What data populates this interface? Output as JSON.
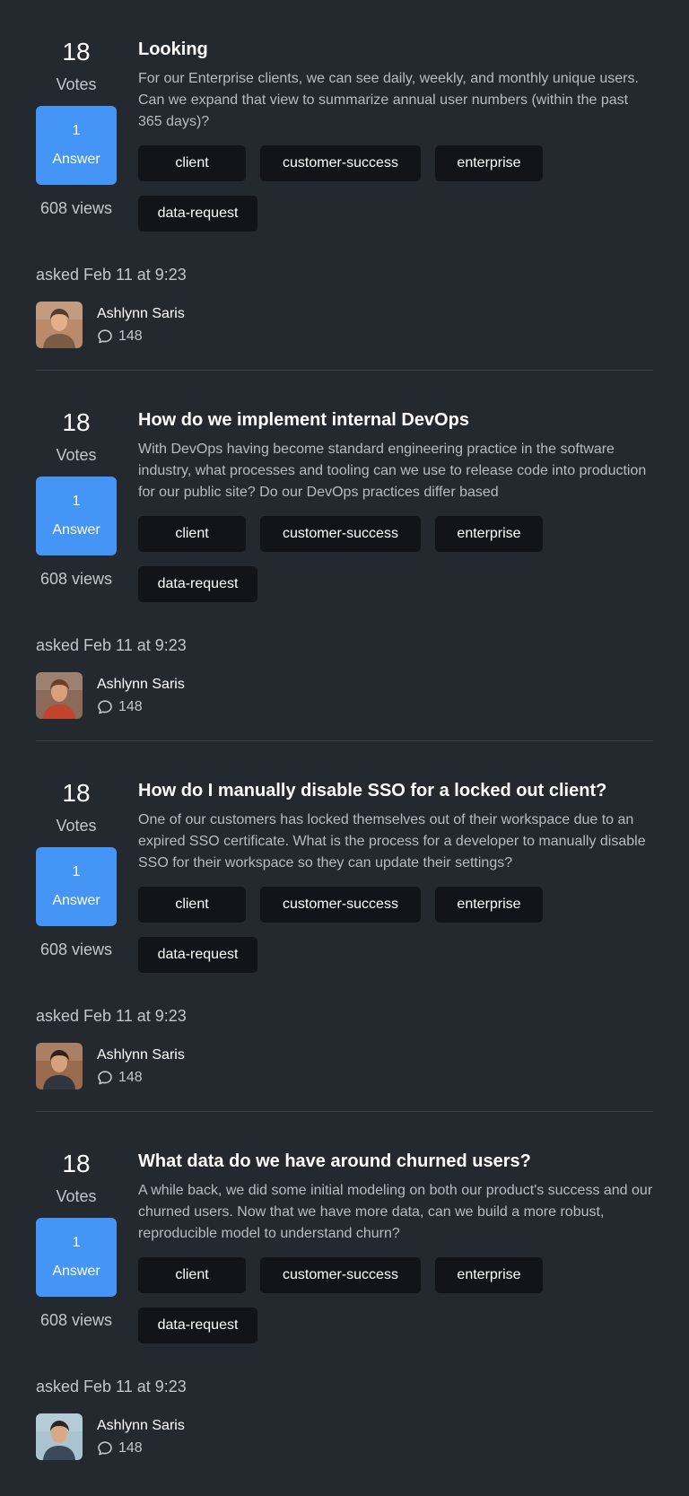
{
  "questions": [
    {
      "votes": "18",
      "votes_label": "Votes",
      "answers": "1",
      "answers_label": "Answer",
      "views": "608 views",
      "title": "Looking",
      "excerpt": "For our Enterprise clients, we can see daily, weekly, and monthly unique users. Can we expand that view to summarize annual user numbers (within the past 365 days)?",
      "tags": [
        "client",
        "customer-success",
        "enterprise",
        "data-request"
      ],
      "asked": "asked Feb 11 at 9:23",
      "author": "Ashlynn Saris",
      "comments": "148",
      "avatar_colors": {
        "bg": "#b98b6a",
        "skin": "#e2b08a",
        "hair": "#5a3b27",
        "shirt": "#7a5c44"
      }
    },
    {
      "votes": "18",
      "votes_label": "Votes",
      "answers": "1",
      "answers_label": "Answer",
      "views": "608 views",
      "title": "How do we implement internal DevOps",
      "excerpt": "With DevOps having become standard engineering practice in the software industry, what processes and tooling can we use to release code into production for our public site? Do our DevOps practices differ based",
      "tags": [
        "client",
        "customer-success",
        "enterprise",
        "data-request"
      ],
      "asked": "asked Feb 11 at 9:23",
      "author": "Ashlynn Saris",
      "comments": "148",
      "avatar_colors": {
        "bg": "#8b6a5a",
        "skin": "#d9a07c",
        "hair": "#6b3f24",
        "shirt": "#c2432e"
      }
    },
    {
      "votes": "18",
      "votes_label": "Votes",
      "answers": "1",
      "answers_label": "Answer",
      "views": "608 views",
      "title": "How do I manually disable SSO for a locked out client?",
      "excerpt": "One of our customers has locked themselves out of their workspace due to an expired SSO certificate. What is the process for a developer to manually disable SSO for their workspace so they can update their settings?",
      "tags": [
        "client",
        "customer-success",
        "enterprise",
        "data-request"
      ],
      "asked": "asked Feb 11 at 9:23",
      "author": "Ashlynn Saris",
      "comments": "148",
      "avatar_colors": {
        "bg": "#9a6a4c",
        "skin": "#d6a27e",
        "hair": "#2e221b",
        "shirt": "#2f3640"
      }
    },
    {
      "votes": "18",
      "votes_label": "Votes",
      "answers": "1",
      "answers_label": "Answer",
      "views": "608 views",
      "title": "What data do we have around churned users?",
      "excerpt": "A while back, we did some initial modeling on both our product's success and our churned users. Now that we have more data, can we build a more robust, reproducible model to understand churn?",
      "tags": [
        "client",
        "customer-success",
        "enterprise",
        "data-request"
      ],
      "asked": "asked Feb 11 at 9:23",
      "author": "Ashlynn Saris",
      "comments": "148",
      "avatar_colors": {
        "bg": "#a9c3cf",
        "skin": "#d9a987",
        "hair": "#2a2420",
        "shirt": "#3b4a5a"
      }
    }
  ],
  "colors": {
    "background": "#24292f",
    "accent": "#4595f7",
    "tag_bg": "#11151a",
    "muted_text": "#c3c7cc"
  }
}
